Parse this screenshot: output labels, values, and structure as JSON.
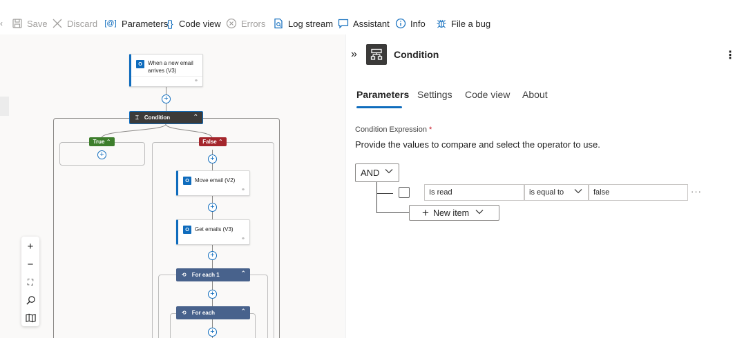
{
  "toolbar": {
    "save_label": "Save",
    "discard_label": "Discard",
    "parameters_label": "Parameters",
    "code_view_label": "Code view",
    "errors_label": "Errors",
    "log_stream_label": "Log stream",
    "assistant_label": "Assistant",
    "info_label": "Info",
    "file_bug_label": "File a bug"
  },
  "canvas": {
    "trigger": {
      "title_line1": "When a new email",
      "title_line2": "arrives (V3)"
    },
    "condition": {
      "title": "Condition"
    },
    "true_branch": {
      "label": "True"
    },
    "false_branch": {
      "label": "False"
    },
    "move_email": {
      "title": "Move email (V2)"
    },
    "get_emails": {
      "title": "Get emails (V3)"
    },
    "for_each_1": {
      "title": "For each 1"
    },
    "for_each": {
      "title": "For each"
    },
    "zoom_controls": [
      "zoom-in",
      "zoom-out",
      "fit-view",
      "search",
      "minimap"
    ]
  },
  "panel": {
    "title": "Condition",
    "tabs": [
      "Parameters",
      "Settings",
      "Code view",
      "About"
    ],
    "active_tab": "Parameters",
    "field_label": "Condition Expression",
    "required_mark": "*",
    "help_text": "Provide the values to compare and select the operator to use.",
    "group_operator": "AND",
    "row": {
      "left_value": "Is read",
      "operator": "is equal to",
      "right_value": "false"
    },
    "more_label": "···",
    "new_item_label": "New item"
  },
  "colors": {
    "accent": "#0f6cbd",
    "true_branch": "#3d7e2c",
    "false_branch": "#a4262c",
    "scope_header": "#48628c",
    "condition_header": "#3b3a39"
  }
}
